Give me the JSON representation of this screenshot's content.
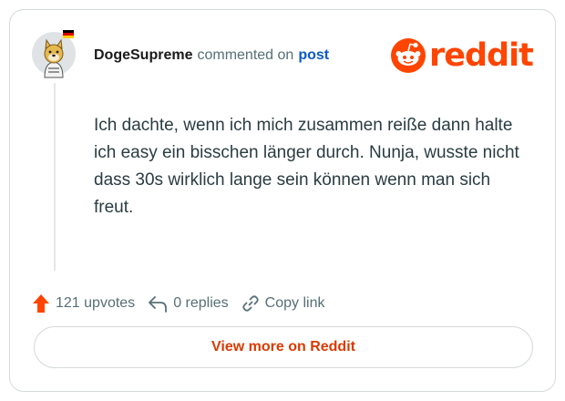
{
  "comment": {
    "author": "DogeSupreme",
    "commented_text": "commented on",
    "post_link": "post",
    "body": "Ich dachte, wenn ich mich zusammen reiße dann halte ich easy ein bisschen länger durch. Nunja, wusste nicht dass 30s wirklich lange sein können wenn man sich freut."
  },
  "brand": {
    "logo_text": "reddit",
    "accent_color": "#ff4500"
  },
  "actions": {
    "upvotes": "121 upvotes",
    "replies": "0 replies",
    "copy_link": "Copy link"
  },
  "footer": {
    "view_more_label": "View more on Reddit"
  },
  "icons": {
    "upvote": "upvote-arrow-icon",
    "reply": "reply-arrow-icon",
    "link": "link-icon",
    "avatar": "doge-avatar",
    "flag": "germany-flag-icon"
  }
}
